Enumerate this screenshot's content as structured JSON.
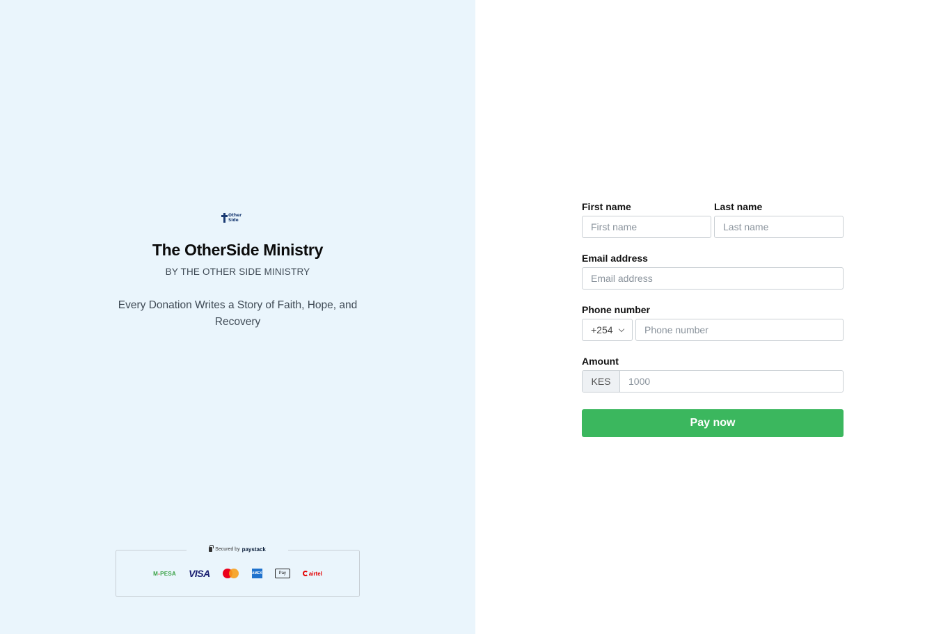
{
  "org": {
    "logo_text": "Other Side",
    "title": "The OtherSide Ministry",
    "subtitle": "BY THE OTHER SIDE MINISTRY",
    "tagline": "Every Donation Writes a Story of Faith, Hope, and Recovery"
  },
  "security": {
    "prefix": "Secured by",
    "brand": "paystack"
  },
  "payment_methods": {
    "mpesa_m": "M",
    "mpesa_rest": "PESA",
    "visa": "VISA",
    "amex": "AMEX",
    "applepay": "Pay",
    "airtel": "airtel"
  },
  "form": {
    "first_name": {
      "label": "First name",
      "placeholder": "First name",
      "value": ""
    },
    "last_name": {
      "label": "Last name",
      "placeholder": "Last name",
      "value": ""
    },
    "email": {
      "label": "Email address",
      "placeholder": "Email address",
      "value": ""
    },
    "phone": {
      "label": "Phone number",
      "country_code": "+254",
      "placeholder": "Phone number",
      "value": ""
    },
    "amount": {
      "label": "Amount",
      "currency": "KES",
      "placeholder": "1000",
      "value": ""
    },
    "submit_label": "Pay now"
  },
  "colors": {
    "left_bg": "#eaf5fc",
    "button_green": "#3bb75e",
    "logo_navy": "#1a3b73"
  }
}
